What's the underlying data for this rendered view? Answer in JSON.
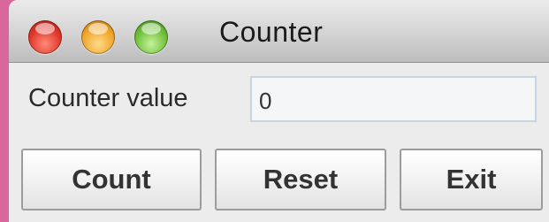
{
  "window": {
    "title": "Counter"
  },
  "form": {
    "label": "Counter value",
    "value": "0"
  },
  "buttons": {
    "count": "Count",
    "reset": "Reset",
    "exit": "Exit"
  }
}
